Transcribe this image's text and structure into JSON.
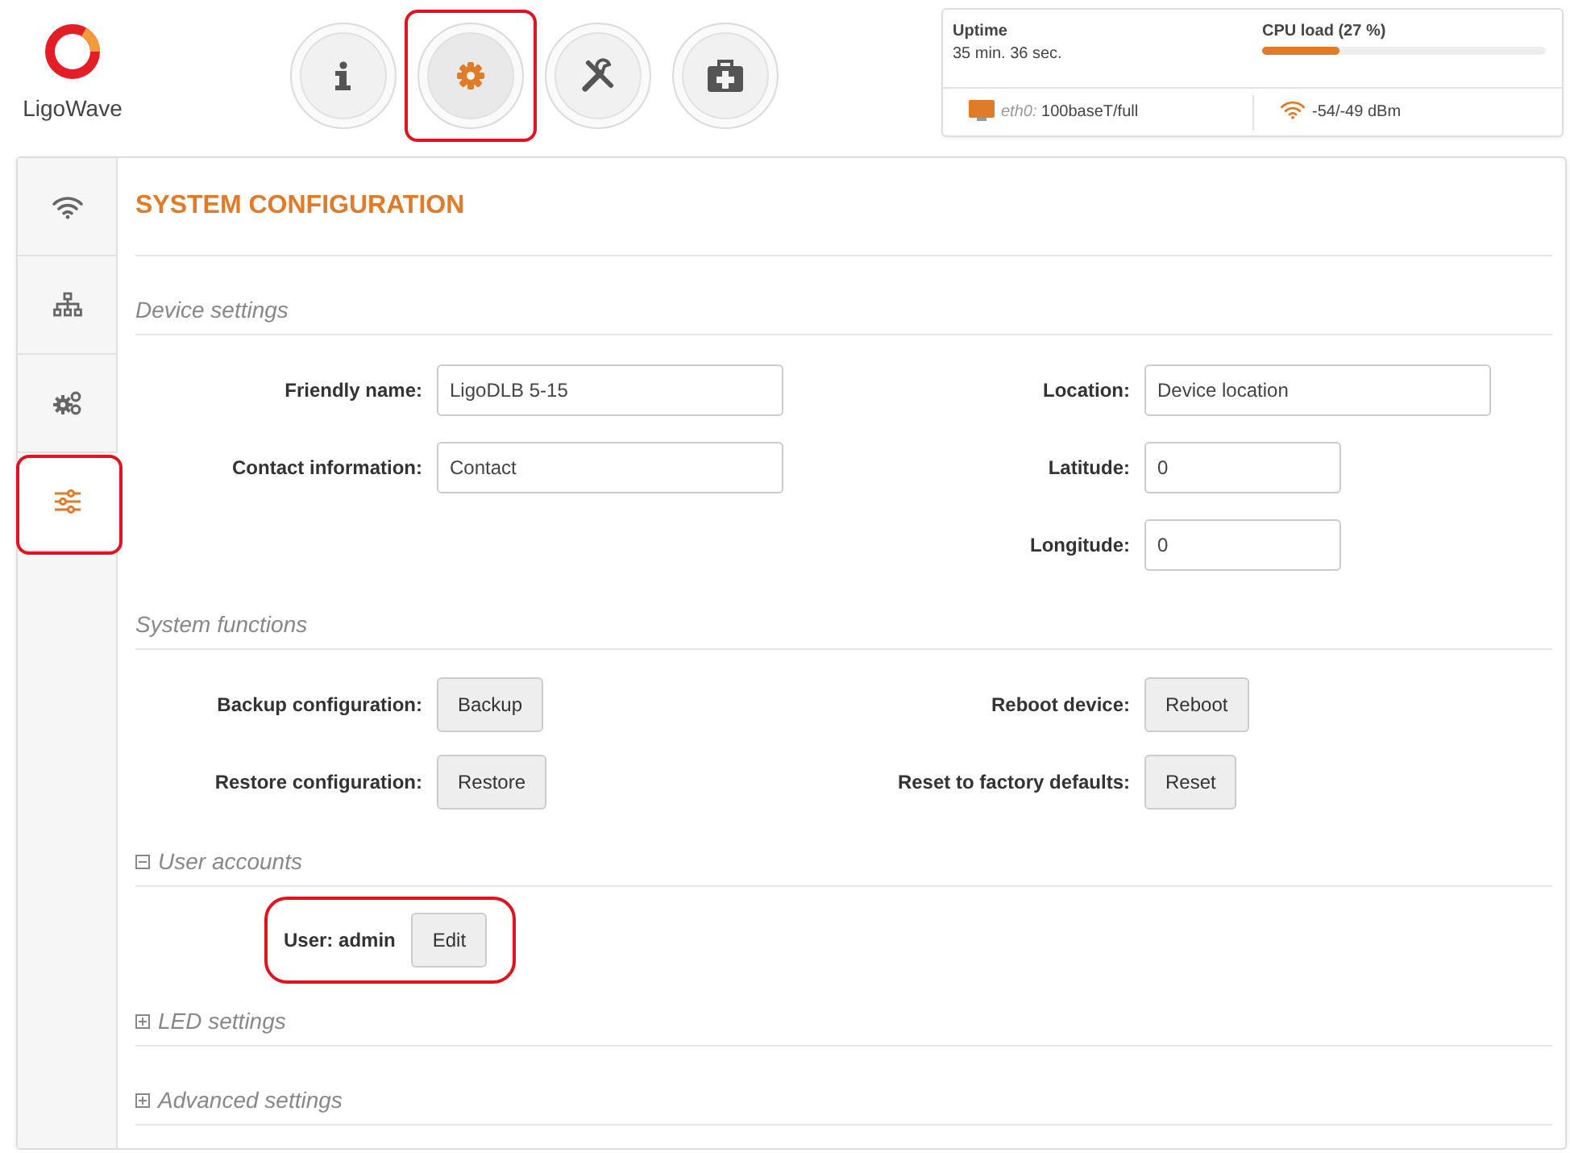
{
  "logo": {
    "text": "LigoWave"
  },
  "nav": [
    {
      "kind": "info",
      "selected": false,
      "highlighted": false
    },
    {
      "kind": "gear",
      "selected": true,
      "highlighted": true
    },
    {
      "kind": "tools",
      "selected": false,
      "highlighted": false
    },
    {
      "kind": "toolbox",
      "selected": false,
      "highlighted": false
    }
  ],
  "status": {
    "uptime_label": "Uptime",
    "uptime": "35 min. 36 sec.",
    "cpu": {
      "label": "CPU load (27 %)",
      "level": 0.27
    },
    "port_name": "eth0:",
    "port_speed": "100baseT/full",
    "signal": "-54/-49 dBm"
  },
  "sidebar": [
    {
      "kind": "wireless",
      "selected": false,
      "highlighted": false
    },
    {
      "kind": "network",
      "selected": false,
      "highlighted": false
    },
    {
      "kind": "services",
      "selected": false,
      "highlighted": false
    },
    {
      "kind": "system",
      "selected": true,
      "highlighted": true
    }
  ],
  "title": "SYSTEM CONFIGURATION",
  "sections": [
    {
      "kind": "fields",
      "title": "Device settings",
      "left": [
        {
          "label": "Friendly name:",
          "value": "LigoDLB 5-15",
          "kind": "text"
        },
        {
          "label": "Contact information:",
          "value": "Contact",
          "kind": "text"
        }
      ],
      "right": [
        {
          "label": "Location:",
          "value": "Device location",
          "kind": "text"
        },
        {
          "label": "Latitude:",
          "value": "0",
          "kind": "number"
        },
        {
          "label": "Longitude:",
          "value": "0",
          "kind": "number"
        }
      ]
    },
    {
      "kind": "buttons",
      "title": "System functions",
      "left": [
        {
          "label": "Backup configuration:",
          "button": "Backup"
        },
        {
          "label": "Restore configuration:",
          "button": "Restore"
        }
      ],
      "right": [
        {
          "label": "Reboot device:",
          "button": "Reboot"
        },
        {
          "label": "Reset to factory defaults:",
          "button": "Reset"
        }
      ]
    },
    {
      "kind": "users",
      "title": "User accounts",
      "expanded": true,
      "users": [
        {
          "label": "User: admin",
          "button": "Edit",
          "highlighted": true
        }
      ]
    },
    {
      "kind": "users",
      "title": "LED settings",
      "expanded": false
    },
    {
      "kind": "users",
      "title": "Advanced settings",
      "expanded": false
    }
  ]
}
